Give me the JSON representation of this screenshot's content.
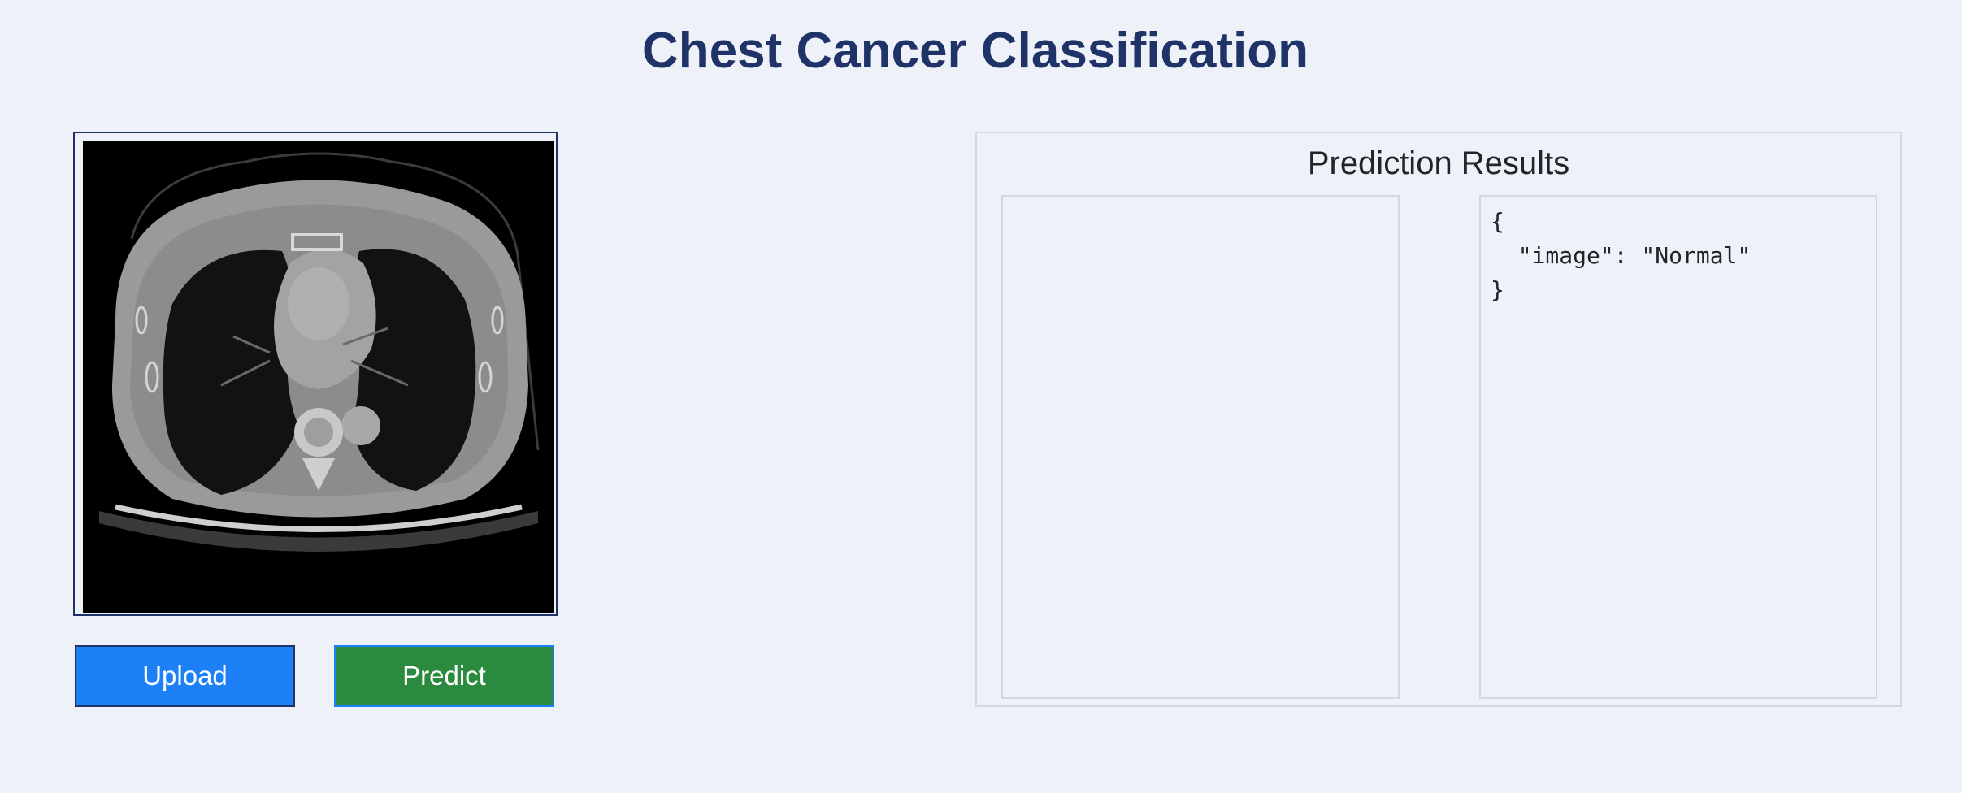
{
  "header": {
    "title": "Chest Cancer Classification"
  },
  "preview": {
    "image_description": "chest-ct-scan-icon"
  },
  "buttons": {
    "upload_label": "Upload",
    "predict_label": "Predict"
  },
  "results": {
    "title": "Prediction Results",
    "json_text": "{\n  \"image\": \"Normal\"\n}"
  },
  "colors": {
    "title": "#1f3368",
    "background": "#eef2f8",
    "upload_button": "#1d80f6",
    "predict_button": "#2a8a3e"
  }
}
